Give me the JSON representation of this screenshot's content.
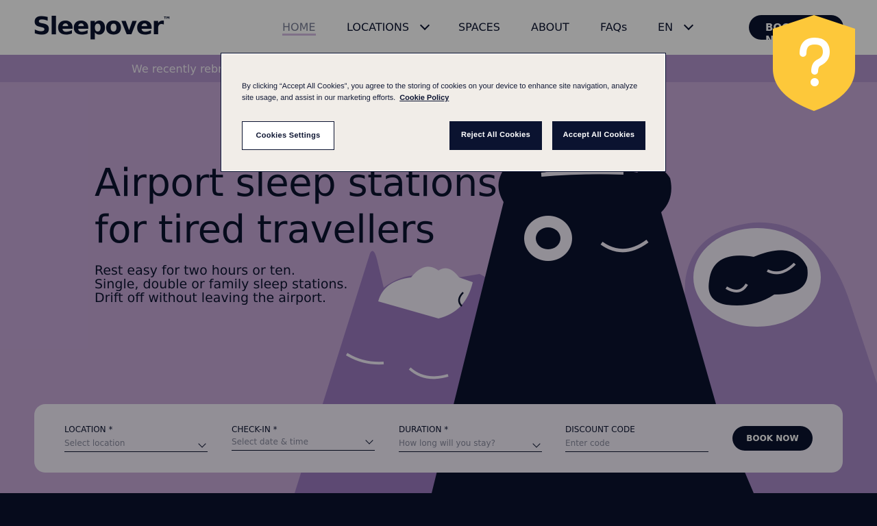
{
  "header": {
    "logo": "Sleepover",
    "logo_mark": "™",
    "nav": {
      "home": "HOME",
      "locations": "LOCATIONS",
      "spaces": "SPACES",
      "about": "ABOUT",
      "faqs": "FAQs",
      "language": "EN"
    },
    "book_label": "BOOK NOW"
  },
  "banner": {
    "text": "We recently rebranded"
  },
  "hero": {
    "title_line1": "Airport sleep stations",
    "title_line2": "for tired travellers",
    "sub_line1": "Rest easy for two hours or ten.",
    "sub_line2": "Single, double or family sleep stations.",
    "sub_line3": "Drift off without leaving the airport."
  },
  "booking": {
    "location_label": "LOCATION *",
    "location_placeholder": "Select location",
    "checkin_label": "CHECK-IN *",
    "checkin_placeholder": "Select date & time",
    "duration_label": "DURATION *",
    "duration_placeholder": "How long will you stay?",
    "discount_label": "DISCOUNT CODE",
    "discount_placeholder": "Enter code",
    "book_label": "BOOK NOW"
  },
  "cookie": {
    "text": "By clicking “Accept All Cookies”, you agree to the storing of cookies on your device to enhance site navigation, analyze site usage, and assist in our marketing efforts.",
    "policy_link": "Cookie Policy",
    "settings_label": "Cookies Settings",
    "reject_label": "Reject All Cookies",
    "accept_label": "Accept All Cookies"
  },
  "help_widget": {
    "icon": "question-shield-icon",
    "color": "#fdc83a"
  },
  "colors": {
    "navy": "#0b1330",
    "lilac": "#c7a9d8",
    "yellow": "#fdc83a"
  }
}
